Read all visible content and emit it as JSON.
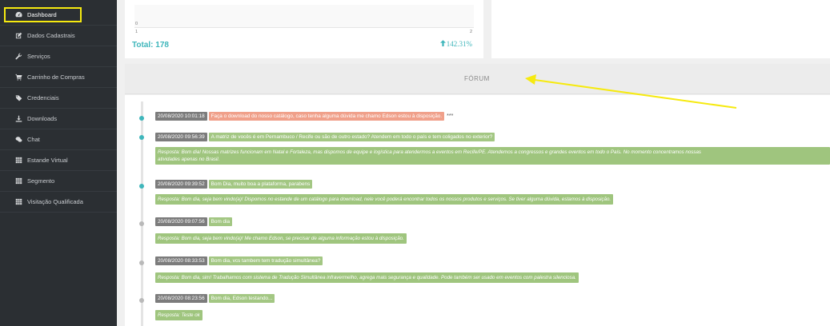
{
  "sidebar": {
    "items": [
      {
        "label": "Dashboard",
        "icon": "dashboard-icon"
      },
      {
        "label": "Dados Cadastrais",
        "icon": "edit-icon"
      },
      {
        "label": "Serviços",
        "icon": "wrench-icon"
      },
      {
        "label": "Carrinho de Compras",
        "icon": "cart-icon"
      },
      {
        "label": "Credenciais",
        "icon": "tag-icon"
      },
      {
        "label": "Downloads",
        "icon": "download-icon"
      },
      {
        "label": "Chat",
        "icon": "chat-icon"
      },
      {
        "label": "Estande Virtual",
        "icon": "grid-icon"
      },
      {
        "label": "Segmento",
        "icon": "grid-icon"
      },
      {
        "label": "Visitação Qualificada",
        "icon": "grid-icon"
      }
    ],
    "highlight_color": "#f6ea10"
  },
  "summary": {
    "chart_tick_y": "0",
    "chart_tick_x1": "1",
    "chart_tick_x2": "2",
    "total": "Total: 178",
    "percent": "142.31%"
  },
  "forum": {
    "title": "FÓRUM",
    "messages": [
      {
        "time": "20/08/2020 10:01:18",
        "question": "Faça o download do nosso catálogo, caso tenha alguma dúvida me chamo Edson estou à disposição.",
        "extra": "***",
        "answer": ""
      },
      {
        "time": "20/08/2020 09:56:39",
        "question": "A matriz de vocês é em Pernambuco / Recife ou são de outro estado? Atendem em todo o país e tem coligados no exterior?",
        "answer_line1": "Resposta: Bom dia! Nossas matrizes funcionam em Natal e Fortaleza, mas dispomos de equipe e logística para atendermos a eventos em Recife/PE. Atendemos a congressos e grandes eventos em todo o País. No momento concentramos nossas",
        "answer_line2": "atividades apenas no Brasil."
      },
      {
        "time": "20/08/2020 09:39:52",
        "question": "Bom Dia, muito boa a plataforma, parabens",
        "answer": "Resposta: Bom dia, seja bem vindo(a)! Dispomos no estande de um catálogo para download, nele você poderá encontrar todos os nossos produtos e serviços. Se tiver alguma dúvida, estamos à disposição."
      },
      {
        "time": "20/08/2020 09:07:56",
        "question": "Bom dia",
        "answer": "Resposta: Bom dia, seja bem vindo(a)! Me chamo Edson, se precisar de alguma informação estou à disposição."
      },
      {
        "time": "20/08/2020 08:33:53",
        "question": "Bom dia, vcs tambem tem tradução simultânea?",
        "answer": "Resposta: Bom dia, sim! Trabalhamos com sistema de Tradução Simultânea infravermelho, agrega mais segurança e qualidade. Pode também ser usado em eventos com palestra silenciosa."
      },
      {
        "time": "20/08/2020 08:23:56",
        "question": "Bom dia, Edson testando...",
        "answer": "Resposta: Teste ok"
      }
    ]
  },
  "colors": {
    "sidebar_bg": "#2b2f33",
    "accent_teal": "#3fb6bb",
    "question_salmon": "#f0a08a",
    "question_green": "#a3c783",
    "answer_green": "#9fc57e",
    "timestamp_grey": "#7c7c7c",
    "annotation_yellow": "#f6ea10"
  }
}
